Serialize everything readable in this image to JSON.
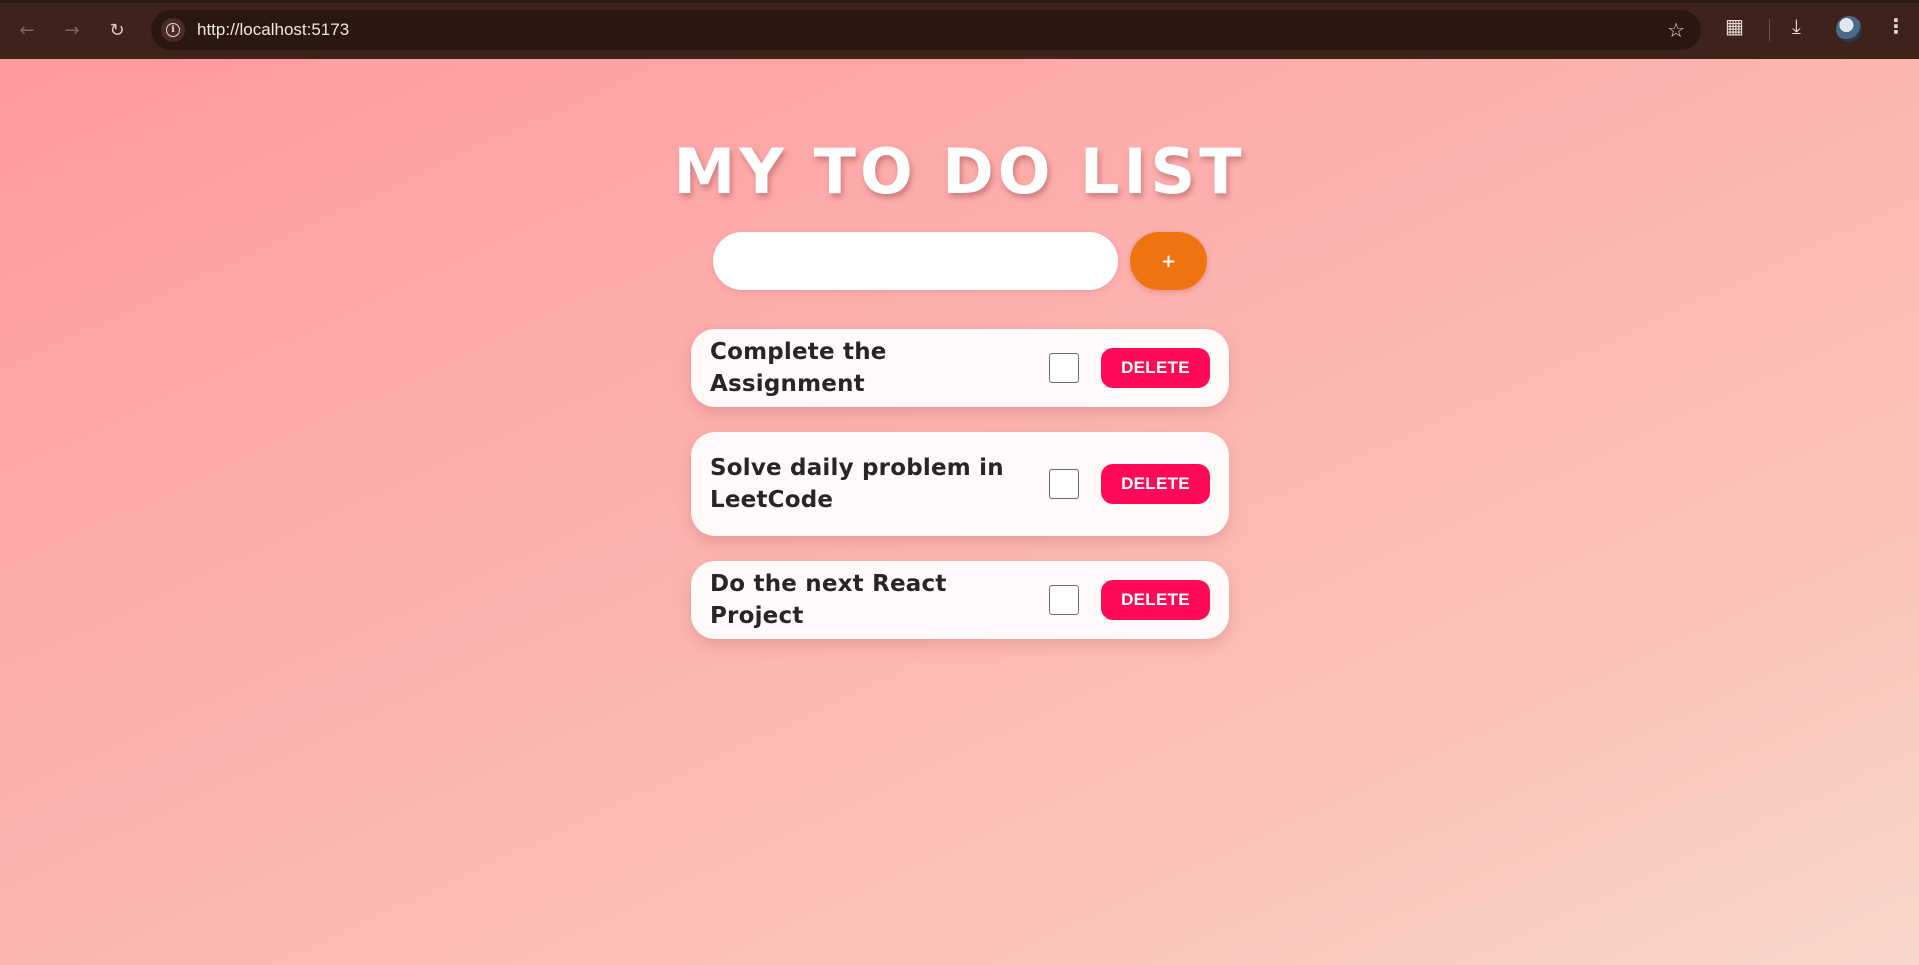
{
  "browser": {
    "url": "http://localhost:5173",
    "icons": {
      "back": "arrow-left",
      "forward": "arrow-right",
      "reload": "reload",
      "site_info": "info",
      "bookmark": "star",
      "extensions": "puzzle",
      "downloads": "download",
      "profile": "avatar",
      "menu": "three-dots-vertical"
    }
  },
  "app": {
    "title": "MY TO DO LIST",
    "input": {
      "value": "",
      "placeholder": ""
    },
    "add_label": "+",
    "colors": {
      "add_button": "#ef7410",
      "delete_button": "#fe0a57",
      "background_start": "#ff9a9e",
      "background_end": "#f8d6cb"
    },
    "todos": [
      {
        "text": "Complete the Assignment",
        "checked": false,
        "delete_label": "DELETE"
      },
      {
        "text": "Solve daily problem in LeetCode",
        "checked": false,
        "delete_label": "DELETE"
      },
      {
        "text": "Do the next React Project",
        "checked": false,
        "delete_label": "DELETE"
      }
    ]
  }
}
